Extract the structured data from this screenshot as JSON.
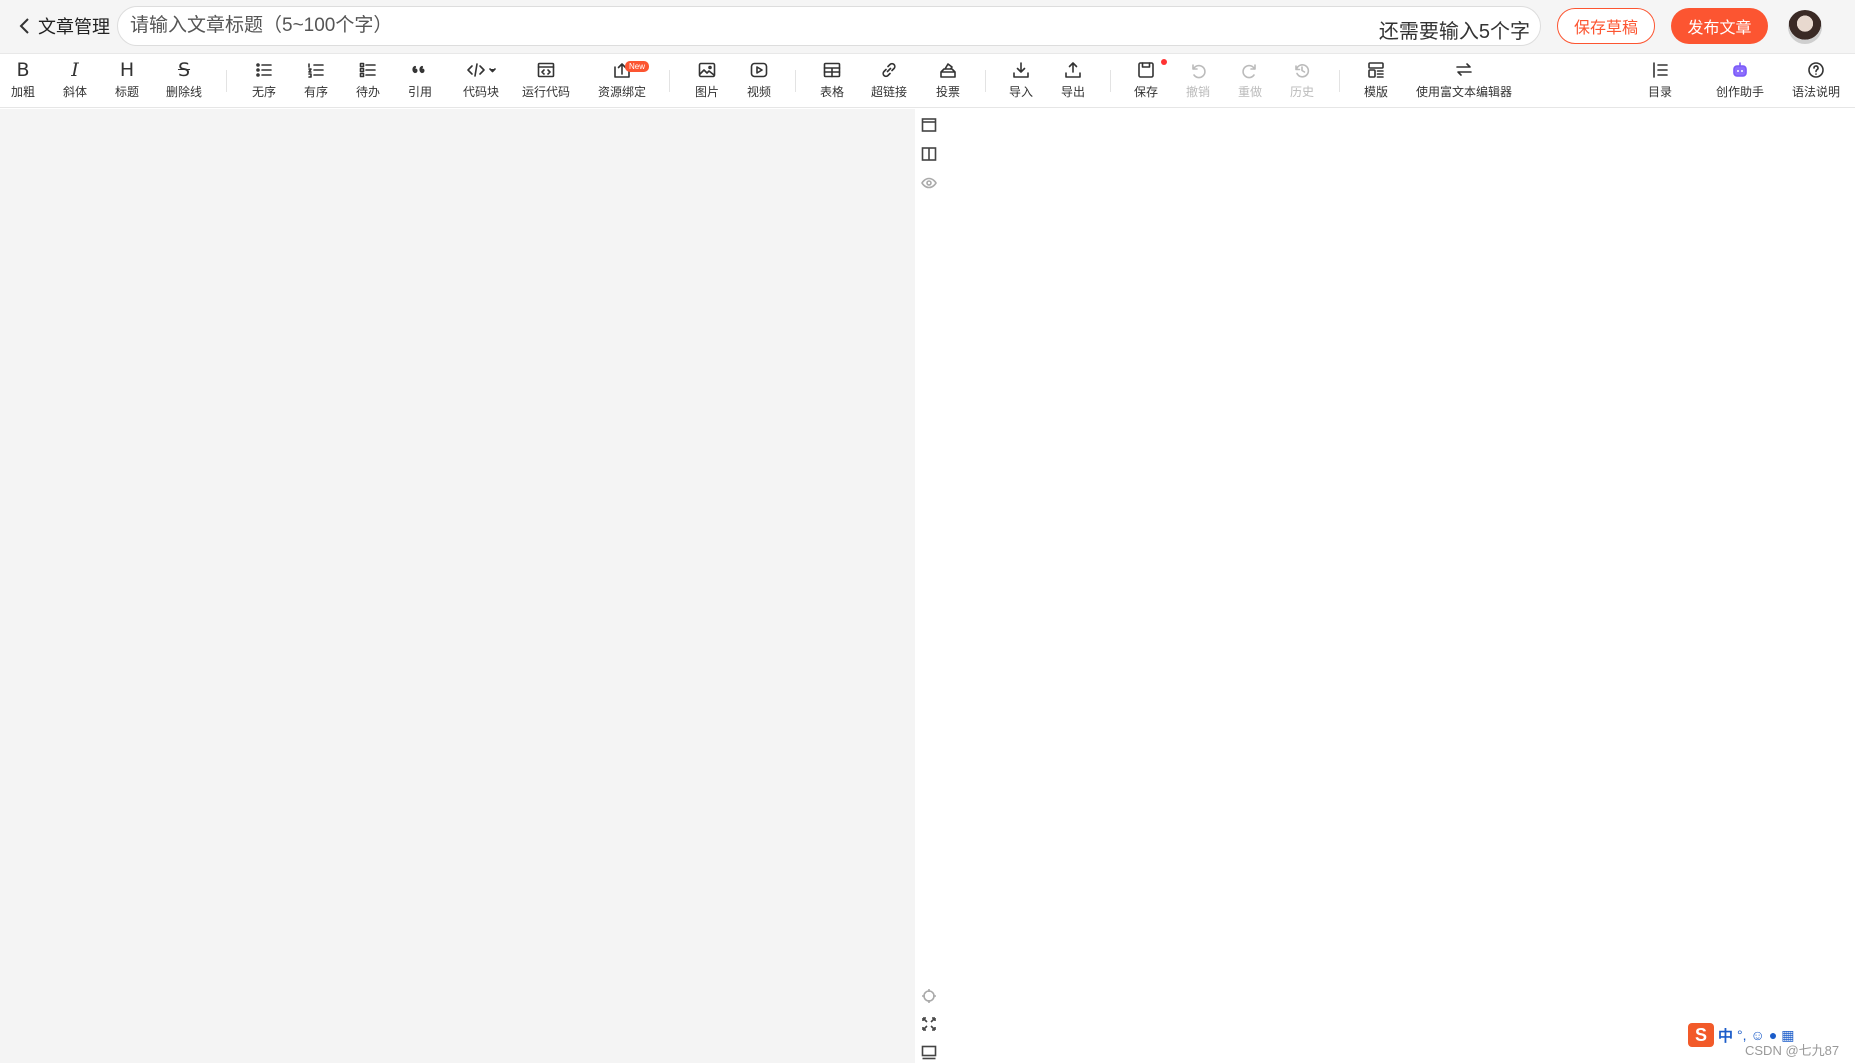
{
  "header": {
    "back_label": "文章管理",
    "title_placeholder": "请输入文章标题（5~100个字）",
    "title_counter": "还需要输入5个字",
    "save_draft_label": "保存草稿",
    "publish_label": "发布文章"
  },
  "toolbar": {
    "bold": "加粗",
    "italic": "斜体",
    "heading": "标题",
    "strike": "删除线",
    "unordered": "无序",
    "ordered": "有序",
    "todo": "待办",
    "quote": "引用",
    "codeblock": "代码块",
    "run_code": "运行代码",
    "resource": "资源绑定",
    "new_badge": "New",
    "image": "图片",
    "video": "视频",
    "table": "表格",
    "link": "超链接",
    "vote": "投票",
    "import": "导入",
    "export": "导出",
    "save": "保存",
    "undo": "撤销",
    "redo": "重做",
    "history": "历史",
    "template": "模版",
    "rich_text": "使用富文本编辑器",
    "toc": "目录",
    "assistant": "创作助手",
    "syntax": "语法说明",
    "letters": {
      "bold": "B",
      "italic": "I",
      "heading": "H",
      "strike": "S"
    }
  },
  "ime": {
    "logo": "S",
    "mode": "中",
    "punct": "°,"
  },
  "watermark": "CSDN @七九87",
  "colors": {
    "accent": "#fc5531",
    "editor_bg": "#f4f4f4"
  }
}
